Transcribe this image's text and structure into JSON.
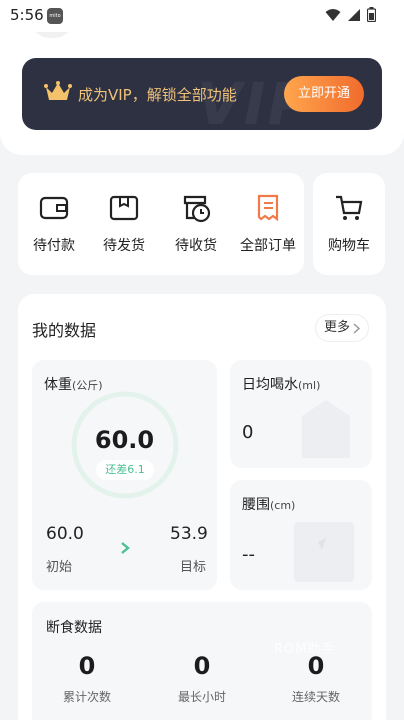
{
  "status_bar": {
    "time": "5:56",
    "app_icon_label": "mito"
  },
  "vip_banner": {
    "text": "成为VIP，解锁全部功能",
    "button_label": "立即开通",
    "watermark": "VIP"
  },
  "orders": {
    "items": [
      {
        "label": "待付款",
        "icon": "wallet-icon"
      },
      {
        "label": "待发货",
        "icon": "box-icon"
      },
      {
        "label": "待收货",
        "icon": "delivery-clock-icon"
      },
      {
        "label": "全部订单",
        "icon": "receipt-icon"
      }
    ],
    "cart_label": "购物车"
  },
  "my_data": {
    "title": "我的数据",
    "more_label": "更多",
    "weight": {
      "title": "体重",
      "unit": "(公斤)",
      "current": "60.0",
      "diff_label": "还差6.1",
      "start_value": "60.0",
      "start_label": "初始",
      "target_value": "53.9",
      "target_label": "目标"
    },
    "water": {
      "title": "日均喝水",
      "unit": "(ml)",
      "value": "0"
    },
    "waist": {
      "title": "腰围",
      "unit": "(cm)",
      "value": "--"
    },
    "fasting": {
      "title": "断食数据",
      "stats": [
        {
          "value": "0",
          "label": "累计次数"
        },
        {
          "value": "0",
          "label": "最长小时"
        },
        {
          "value": "0",
          "label": "连续天数"
        }
      ]
    }
  },
  "watermark": "ROM助手",
  "colors": {
    "accent_orange": "#f06b2d",
    "vip_dark": "#2d3142",
    "vip_gold": "#f0c27a",
    "weight_green": "#4cbf93"
  }
}
